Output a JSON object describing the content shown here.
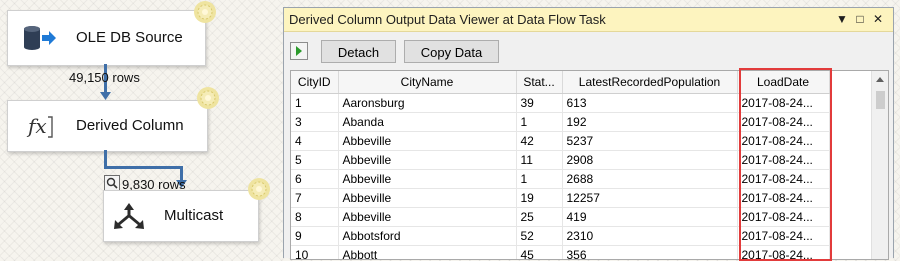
{
  "canvas": {
    "ole_label": "OLE DB Source",
    "derived_label": "Derived Column",
    "multicast_label": "Multicast",
    "rows_1": "49,150 rows",
    "rows_2": "9,830 rows"
  },
  "viewer": {
    "title": "Derived Column Output Data Viewer at Data Flow Task",
    "buttons": {
      "detach": "Detach",
      "copy": "Copy Data"
    },
    "columns": [
      "CityID",
      "CityName",
      "Stat...",
      "LatestRecordedPopulation",
      "LoadDate"
    ],
    "rows": [
      [
        "1",
        "Aaronsburg",
        "39",
        "613",
        "2017-08-24..."
      ],
      [
        "3",
        "Abanda",
        "1",
        "192",
        "2017-08-24..."
      ],
      [
        "4",
        "Abbeville",
        "42",
        "5237",
        "2017-08-24..."
      ],
      [
        "5",
        "Abbeville",
        "11",
        "2908",
        "2017-08-24..."
      ],
      [
        "6",
        "Abbeville",
        "1",
        "2688",
        "2017-08-24..."
      ],
      [
        "7",
        "Abbeville",
        "19",
        "12257",
        "2017-08-24..."
      ],
      [
        "8",
        "Abbeville",
        "25",
        "419",
        "2017-08-24..."
      ],
      [
        "9",
        "Abbotsford",
        "52",
        "2310",
        "2017-08-24..."
      ],
      [
        "10",
        "Abbott",
        "45",
        "356",
        "2017-08-24..."
      ]
    ]
  },
  "colors": {
    "title_bg": "#fdf4bf",
    "connector": "#3f6fa8",
    "highlight": "#e23b3b"
  },
  "icons": [
    "ole-db-source-icon",
    "derived-column-fx-icon",
    "multicast-icon",
    "status-sun-icon",
    "data-viewer-icon",
    "play-icon"
  ]
}
